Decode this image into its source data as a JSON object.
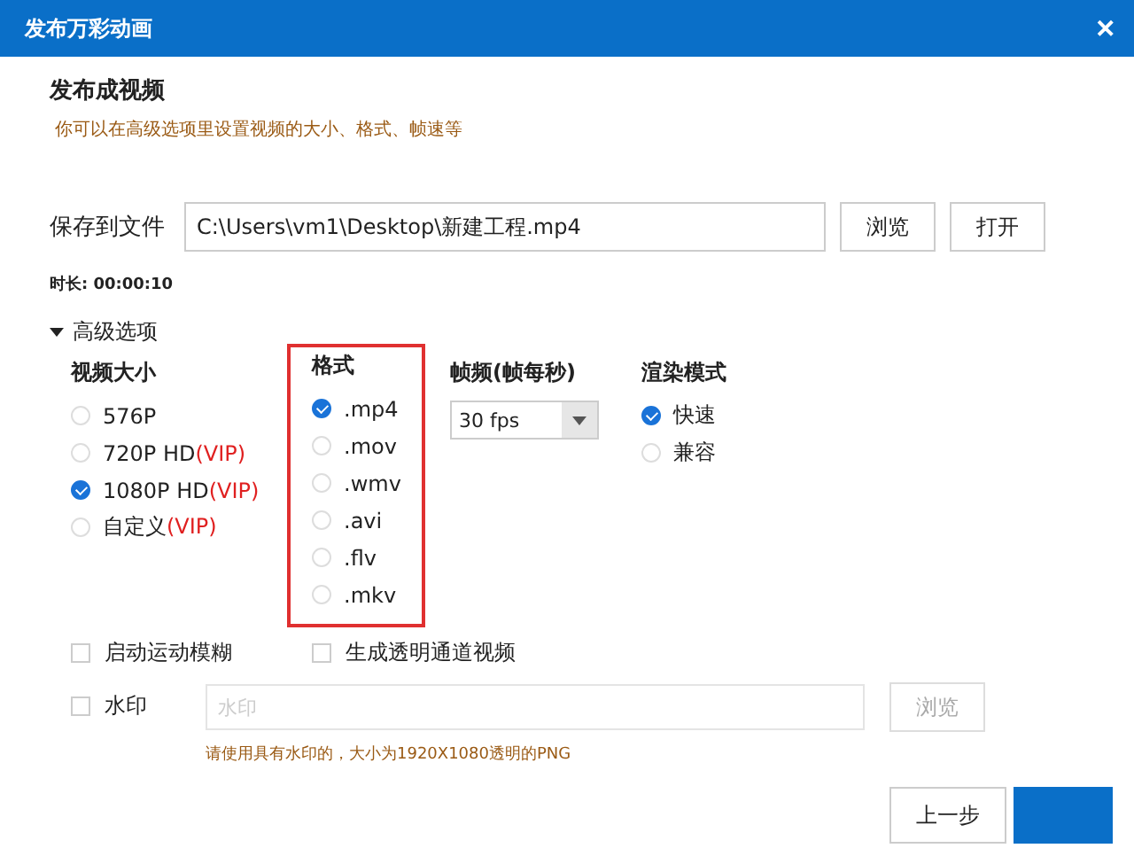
{
  "window": {
    "title": "发布万彩动画",
    "close": "✕"
  },
  "heading": "发布成视频",
  "hint": "你可以在高级选项里设置视频的大小、格式、帧速等",
  "save": {
    "label": "保存到文件",
    "value": "C:\\Users\\vm1\\Desktop\\新建工程.mp4",
    "buttons": [
      "浏览",
      "打开"
    ]
  },
  "duration": "时长: 00:00:10",
  "advanced": {
    "label": "高级选项",
    "expanded": true
  },
  "sizes": {
    "title": "视频大小",
    "options": [
      {
        "label": "576P",
        "selected": false
      },
      {
        "label": "720P HD",
        "vip": "(VIP)",
        "selected": false
      },
      {
        "label": "1080P HD",
        "vip": "(VIP)",
        "selected": true
      },
      {
        "label": "自定义",
        "vip": "(VIP)",
        "selected": false
      }
    ]
  },
  "formats": {
    "title": "格式",
    "highlighted": true,
    "options": [
      {
        "label": ".mp4",
        "selected": true
      },
      {
        "label": ".mov",
        "selected": false
      },
      {
        "label": ".wmv",
        "selected": false
      },
      {
        "label": ".avi",
        "selected": false
      },
      {
        "label": ".flv",
        "selected": false
      },
      {
        "label": ".mkv",
        "selected": false
      }
    ]
  },
  "framerate": {
    "title": "帧频(帧每秒)",
    "value": "30 fps"
  },
  "render": {
    "title": "渲染模式",
    "options": [
      {
        "label": "快速",
        "selected": true
      },
      {
        "label": "兼容",
        "selected": false
      }
    ]
  },
  "checks": [
    {
      "label": "启动运动模糊",
      "checked": false
    },
    {
      "label": "生成透明通道视频",
      "checked": false
    }
  ],
  "watermark": {
    "label": "水印",
    "checked": false,
    "placeholder": "水印",
    "button": "浏览",
    "disabled": true,
    "note": "请使用具有水印的，大小为1920X1080透明的PNG"
  },
  "footer": {
    "back": "上一步"
  }
}
